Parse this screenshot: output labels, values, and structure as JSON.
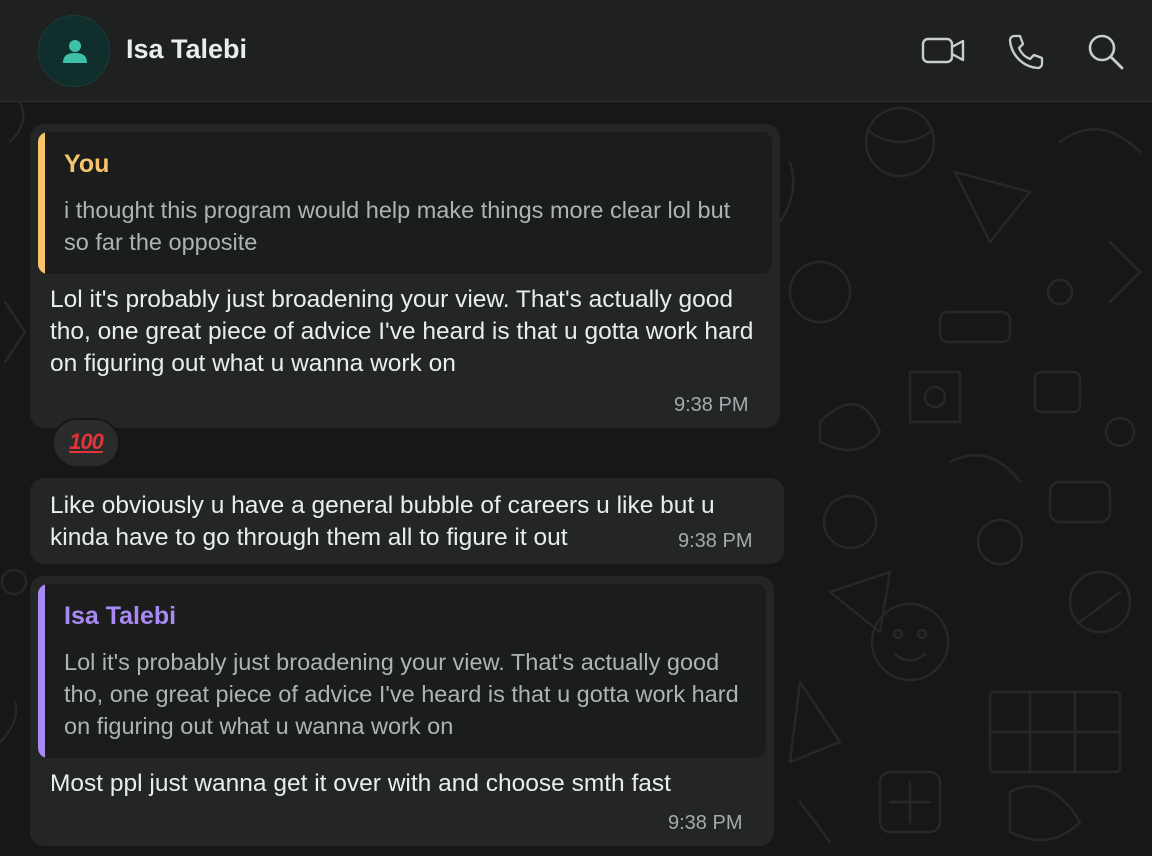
{
  "header": {
    "contact_name": "Isa Talebi",
    "icons": [
      "person-icon",
      "video-call-icon",
      "phone-icon",
      "search-icon"
    ]
  },
  "colors": {
    "you_accent": "#f7c46c",
    "contact_accent": "#a98af5",
    "bubble_bg": "#242626",
    "chat_bg": "#161717"
  },
  "messages": [
    {
      "quote": {
        "author": "You",
        "text": "i thought this program would help make things more clear lol but so far the opposite"
      },
      "text": "Lol it's probably just broadening your view. That's actually good tho, one great piece of advice I've heard is that u gotta work hard on figuring out what u wanna work on",
      "time": "9:38 PM",
      "reaction": "100"
    },
    {
      "text": "Like obviously u have a general bubble of careers u like but u kinda have to go through them all to figure it out",
      "time": "9:38 PM"
    },
    {
      "quote": {
        "author": "Isa Talebi",
        "text": "Lol it's probably just broadening your view. That's actually good tho, one great piece of advice I've heard is that u gotta work hard on figuring out what u wanna work on"
      },
      "text": "Most ppl just wanna get it over with and choose smth fast",
      "time": "9:38 PM"
    }
  ]
}
